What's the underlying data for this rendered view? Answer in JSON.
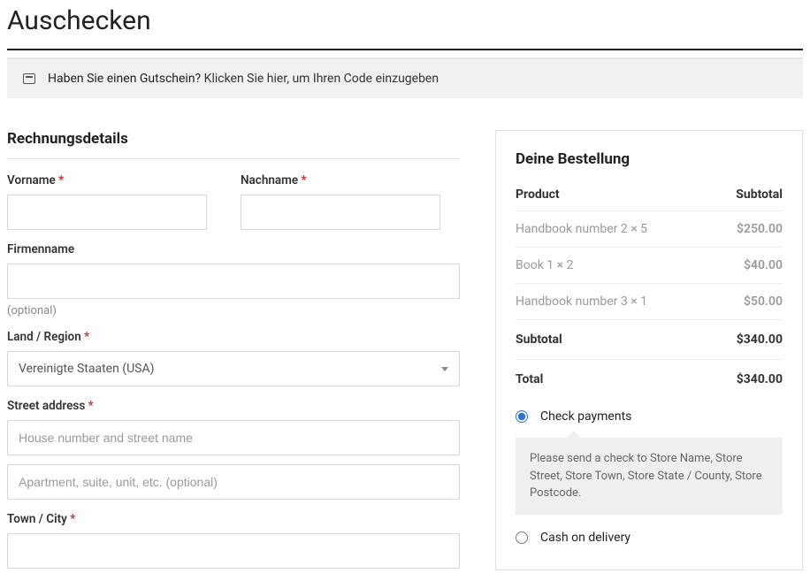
{
  "page": {
    "title": "Auschecken"
  },
  "coupon": {
    "question": "Haben Sie einen Gutschein?",
    "link": "Klicken Sie hier, um Ihren Code einzugeben"
  },
  "billing": {
    "heading": "Rechnungsdetails",
    "firstname_label": "Vorname",
    "lastname_label": "Nachname",
    "company_label": "Firmenname",
    "company_optional": "(optional)",
    "country_label": "Land / Region",
    "country_value": "Vereinigte Staaten (USA)",
    "street_label": "Street address",
    "street_placeholder": "House number and street name",
    "street2_placeholder": "Apartment, suite, unit, etc. (optional)",
    "city_label": "Town / City"
  },
  "order": {
    "heading": "Deine Bestellung",
    "col_product": "Product",
    "col_subtotal": "Subtotal",
    "items": [
      {
        "name": "Handbook number 2",
        "qty": "× 5",
        "price": "$250.00"
      },
      {
        "name": "Book 1",
        "qty": "× 2",
        "price": "$40.00"
      },
      {
        "name": "Handbook number 3",
        "qty": "× 1",
        "price": "$50.00"
      }
    ],
    "subtotal_label": "Subtotal",
    "subtotal_value": "$340.00",
    "total_label": "Total",
    "total_value": "$340.00"
  },
  "payment": {
    "check_label": "Check payments",
    "check_desc": "Please send a check to Store Name, Store Street, Store Town, Store State / County, Store Postcode.",
    "cod_label": "Cash on delivery"
  }
}
